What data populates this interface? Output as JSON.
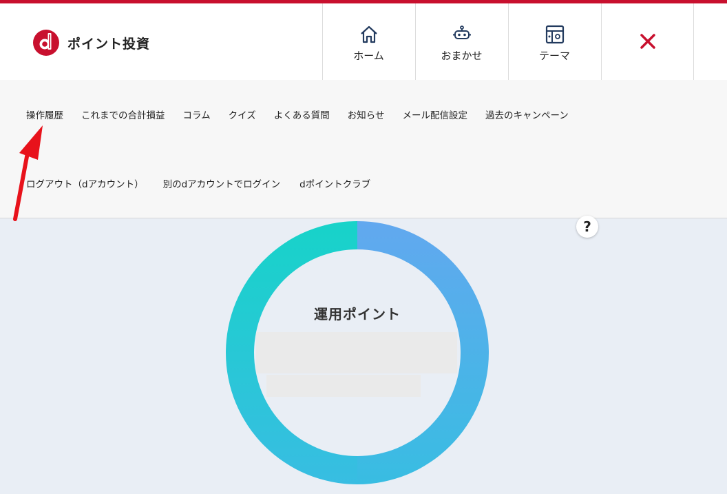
{
  "colors": {
    "accent": "#c8102e",
    "ring_left": "#1fd0c8",
    "ring_right": "#5ea8ef",
    "icon": "#223a5e"
  },
  "header": {
    "brand": "ポイント投資",
    "nav": [
      {
        "label": "ホーム",
        "icon": "home-icon"
      },
      {
        "label": "おまかせ",
        "icon": "robot-icon"
      },
      {
        "label": "テーマ",
        "icon": "theme-icon"
      }
    ],
    "close_icon": "close-icon"
  },
  "menu": {
    "row1": [
      "操作履歴",
      "これまでの合計損益",
      "コラム",
      "クイズ",
      "よくある質問",
      "お知らせ",
      "メール配信設定",
      "過去のキャンペーン"
    ],
    "row2": [
      "ログアウト（dアカウント）",
      "別のdアカウントでログイン",
      "dポイントクラブ"
    ]
  },
  "main": {
    "help": "?",
    "title": "運用ポイント"
  }
}
